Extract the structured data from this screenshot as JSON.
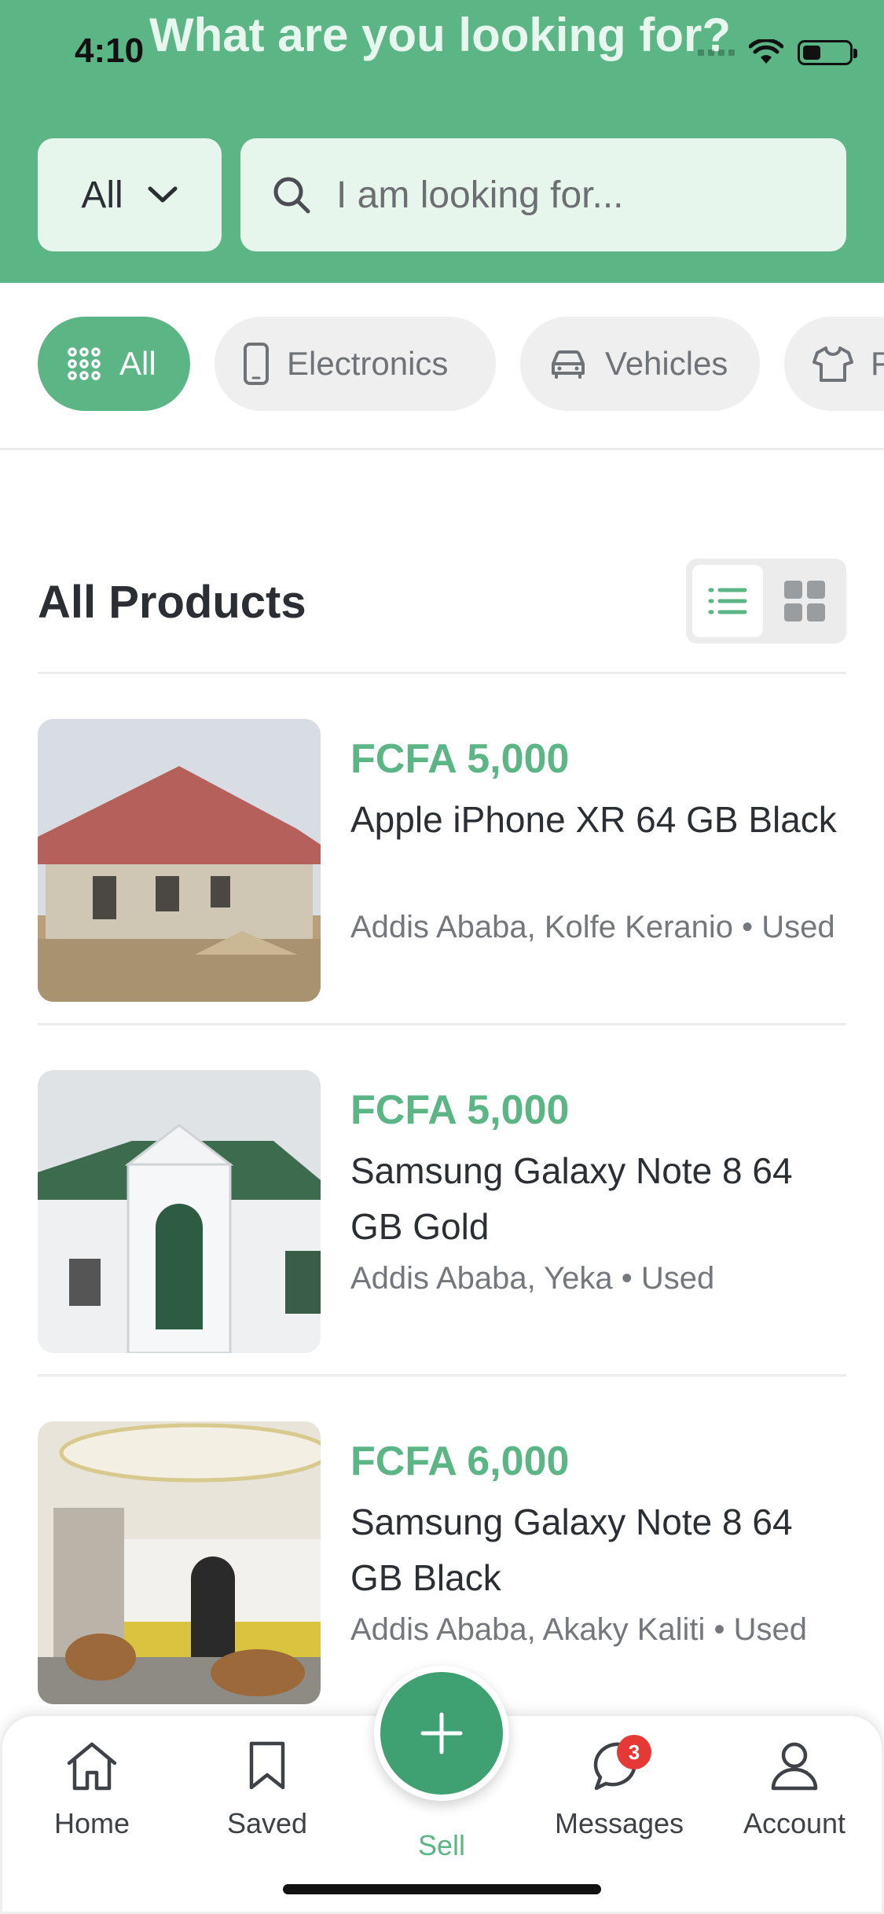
{
  "status_bar": {
    "time": "4:10"
  },
  "header": {
    "title": "What are you looking for?",
    "filter_value": "All",
    "search_placeholder": "I am looking for..."
  },
  "categories": [
    {
      "label": "All",
      "icon": "grid-dots-icon",
      "active": true
    },
    {
      "label": "Electronics",
      "icon": "phone-icon",
      "active": false
    },
    {
      "label": "Vehicles",
      "icon": "car-icon",
      "active": false
    },
    {
      "label": "F",
      "icon": "shirt-icon",
      "active": false
    }
  ],
  "section": {
    "title": "All Products",
    "view_modes": [
      "list-view-icon",
      "grid-view-icon"
    ],
    "active_view": "list"
  },
  "products": [
    {
      "price": "FCFA 5,000",
      "title": "Apple iPhone XR 64 GB Black",
      "location": "Addis Ababa, Kolfe Keranio",
      "condition": "Used",
      "image": "house-red-roof"
    },
    {
      "price": "FCFA 5,000",
      "title": "Samsung Galaxy Note 8 64 GB Gold",
      "location": "Addis Ababa, Yeka",
      "condition": "Used",
      "image": "house-white-green-roof"
    },
    {
      "price": "FCFA 6,000",
      "title": "Samsung Galaxy Note 8 64 GB Black",
      "location": "Addis Ababa, Akaky Kaliti",
      "condition": "Used",
      "image": "living-room"
    }
  ],
  "separator": "•",
  "tabbar": {
    "home": "Home",
    "saved": "Saved",
    "sell": "Sell",
    "messages": "Messages",
    "messages_badge": "3",
    "account": "Account"
  },
  "colors": {
    "brand": "#5bb585",
    "brand_dark": "#3fa071",
    "badge": "#e53935"
  }
}
